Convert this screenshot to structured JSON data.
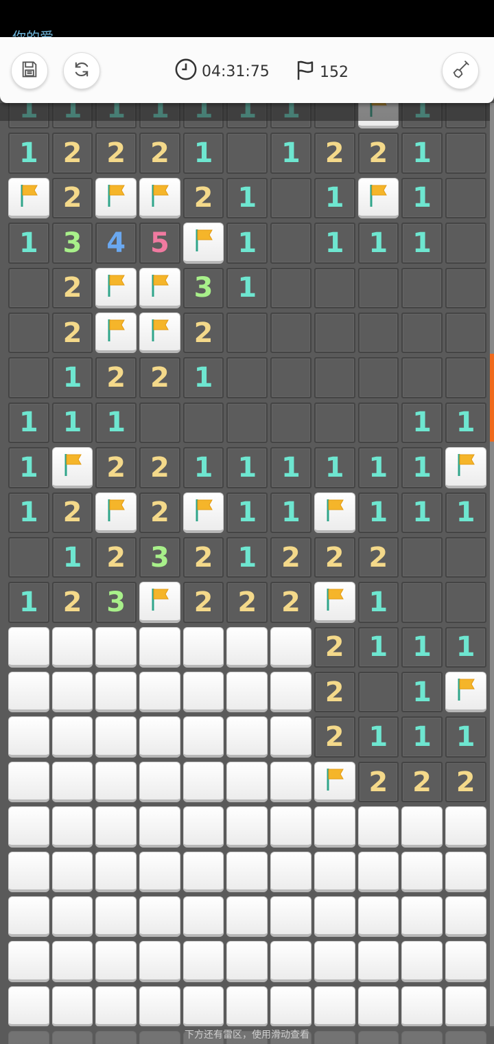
{
  "status_bar": {
    "label": "你的爱"
  },
  "toolbar": {
    "save_icon": "floppy-disk-icon",
    "restart_icon": "refresh-icon",
    "timer_icon": "clock-icon",
    "timer": "04:31:75",
    "flags_icon": "flag-icon",
    "flags_count": "152",
    "shovel_icon": "shovel-icon"
  },
  "board": {
    "legend": "'#'=covered, 'F'=flag, '0'=opened empty, digit=opened number",
    "rows": [
      "11111110F10",
      "12221012210",
      "F2FF2101F10",
      "1345F101110",
      "02FF3100000",
      "02FF2000000",
      "01221000000",
      "11100000011",
      "1F22111111F",
      "12F2F11F111",
      "01232122200",
      "123F222F100",
      "#######2111",
      "#######201F",
      "#######2111",
      "#######F222",
      "###########",
      "###########",
      "###########",
      "###########",
      "###########",
      "###########"
    ]
  },
  "colors": {
    "n1": "#6ee6d0",
    "n2": "#f4d98a",
    "n3": "#a8f08a",
    "n4": "#6aa8f0",
    "n5": "#f07aa0",
    "scroll_accent": "#f06a1c"
  },
  "hint": "下方还有雷区，使用滑动查看"
}
